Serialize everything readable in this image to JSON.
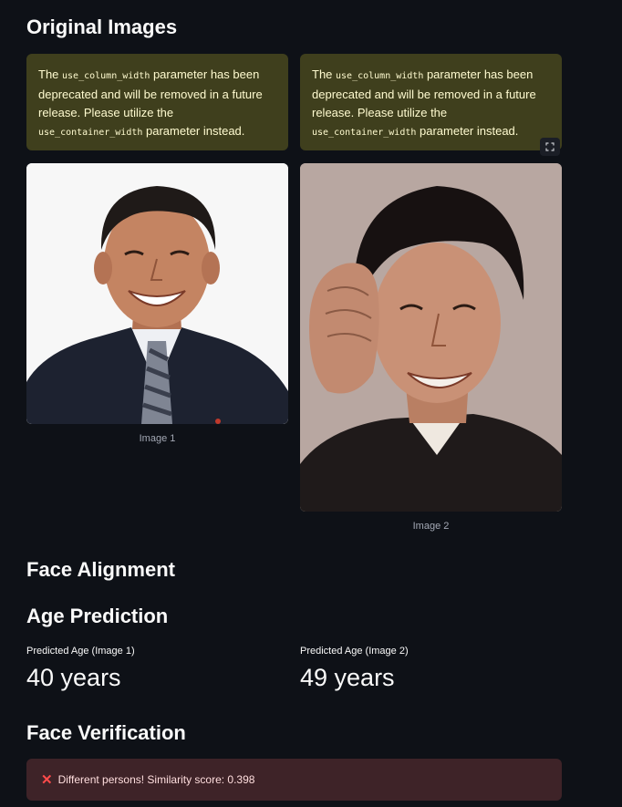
{
  "sections": {
    "original_images": "Original Images",
    "face_alignment": "Face Alignment",
    "age_prediction": "Age Prediction",
    "face_verification": "Face Verification"
  },
  "warning": {
    "pre": "The ",
    "code1": "use_column_width",
    "mid": " parameter has been deprecated and will be removed in a future release. Please utilize the ",
    "code2": "use_container_width",
    "post": " parameter instead."
  },
  "images": [
    {
      "caption": "Image 1"
    },
    {
      "caption": "Image 2"
    }
  ],
  "fullscreen_icon": "expand-icon",
  "metrics": [
    {
      "label": "Predicted Age (Image 1)",
      "value": "40 years"
    },
    {
      "label": "Predicted Age (Image 2)",
      "value": "49 years"
    }
  ],
  "verification": {
    "icon": "cross-mark-icon",
    "message": "Different persons! Similarity score: 0.398",
    "color": "#ff4b4b"
  }
}
